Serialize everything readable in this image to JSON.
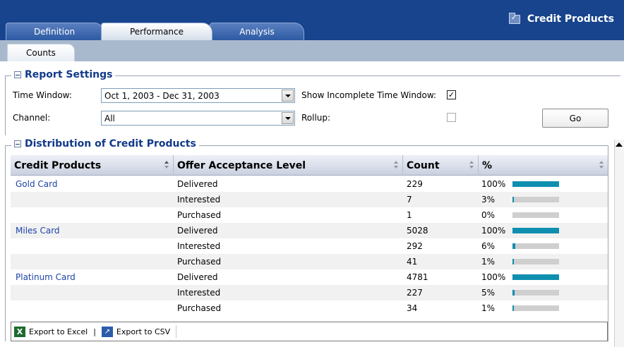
{
  "header": {
    "title": "Credit Products",
    "tabs": [
      {
        "label": "Definition"
      },
      {
        "label": "Performance"
      },
      {
        "label": "Analysis"
      }
    ],
    "subtab": "Counts"
  },
  "report_settings": {
    "legend": "Report Settings",
    "time_window_label": "Time Window:",
    "time_window_value": "Oct 1, 2003 - Dec 31, 2003",
    "channel_label": "Channel:",
    "channel_value": "All",
    "show_incomplete_label": "Show Incomplete Time Window:",
    "show_incomplete_checked": true,
    "rollup_label": "Rollup:",
    "rollup_checked": false,
    "go_label": "Go"
  },
  "distribution": {
    "legend": "Distribution of Credit Products",
    "columns": [
      "Credit Products",
      "Offer Acceptance Level",
      "Count",
      "%"
    ],
    "rows": [
      {
        "product": "Gold Card",
        "level": "Delivered",
        "count": "229",
        "pct": "100%",
        "fraction": 1.0
      },
      {
        "product": "",
        "level": "Interested",
        "count": "7",
        "pct": "3%",
        "fraction": 0.03
      },
      {
        "product": "",
        "level": "Purchased",
        "count": "1",
        "pct": "0%",
        "fraction": 0.0
      },
      {
        "product": "Miles Card",
        "level": "Delivered",
        "count": "5028",
        "pct": "100%",
        "fraction": 1.0
      },
      {
        "product": "",
        "level": "Interested",
        "count": "292",
        "pct": "6%",
        "fraction": 0.06
      },
      {
        "product": "",
        "level": "Purchased",
        "count": "41",
        "pct": "1%",
        "fraction": 0.01
      },
      {
        "product": "Platinum Card",
        "level": "Delivered",
        "count": "4781",
        "pct": "100%",
        "fraction": 1.0
      },
      {
        "product": "",
        "level": "Interested",
        "count": "227",
        "pct": "5%",
        "fraction": 0.05
      },
      {
        "product": "",
        "level": "Purchased",
        "count": "34",
        "pct": "1%",
        "fraction": 0.01
      }
    ]
  },
  "footer": {
    "export_excel": "Export to Excel",
    "separator": "|",
    "export_csv": "Export to CSV"
  },
  "colors": {
    "header_bg": "#17448c",
    "bar_fill": "#0f8fb0",
    "bar_track": "#cfcfcf",
    "link": "#1c44a6"
  }
}
